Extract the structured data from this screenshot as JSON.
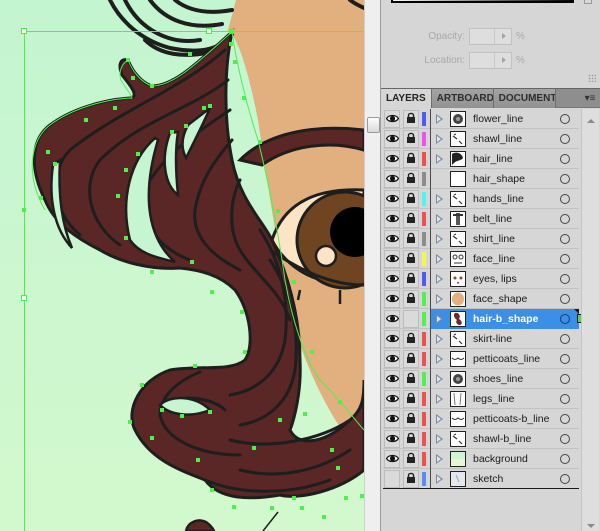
{
  "gradient_panel": {
    "opacity_label": "Opacity:",
    "opacity_value": "",
    "opacity_unit": "%",
    "location_label": "Location:",
    "location_value": "",
    "location_unit": "%"
  },
  "tabs": [
    {
      "label": "LAYERS",
      "active": true
    },
    {
      "label": "ARTBOARD",
      "active": false
    },
    {
      "label": "DOCUMENT",
      "active": false
    }
  ],
  "tab_menu_icon": "panel-menu-icon",
  "layers": [
    {
      "name": "flower_line",
      "visible": true,
      "locked": true,
      "color": "#4f5bf5",
      "expandable": true,
      "selected": false,
      "thumb": "flower"
    },
    {
      "name": "shawl_line",
      "visible": true,
      "locked": true,
      "color": "#f24ff0",
      "expandable": true,
      "selected": false,
      "thumb": "lines"
    },
    {
      "name": "hair_line",
      "visible": true,
      "locked": true,
      "color": "#f24f4f",
      "expandable": true,
      "selected": false,
      "thumb": "hair"
    },
    {
      "name": "hair_shape",
      "visible": true,
      "locked": true,
      "color": "#8c8c8c",
      "expandable": false,
      "selected": false,
      "thumb": "blank"
    },
    {
      "name": "hands_line",
      "visible": true,
      "locked": true,
      "color": "#4ff5f5",
      "expandable": true,
      "selected": false,
      "thumb": "lines"
    },
    {
      "name": "belt_line",
      "visible": true,
      "locked": true,
      "color": "#f24f4f",
      "expandable": true,
      "selected": false,
      "thumb": "belt"
    },
    {
      "name": "shirt_line",
      "visible": true,
      "locked": true,
      "color": "#8c8c8c",
      "expandable": true,
      "selected": false,
      "thumb": "lines"
    },
    {
      "name": "face_line",
      "visible": true,
      "locked": true,
      "color": "#f5f54f",
      "expandable": true,
      "selected": false,
      "thumb": "face"
    },
    {
      "name": "eyes, lips",
      "visible": true,
      "locked": true,
      "color": "#4f5bf5",
      "expandable": true,
      "selected": false,
      "thumb": "eyes"
    },
    {
      "name": "face_shape",
      "visible": true,
      "locked": true,
      "color": "#4ff24f",
      "expandable": true,
      "selected": false,
      "thumb": "faceshape"
    },
    {
      "name": "hair-b_shape",
      "visible": true,
      "locked": false,
      "color": "#4ff24f",
      "expandable": true,
      "selected": true,
      "thumb": "hairb"
    },
    {
      "name": "skirt-line",
      "visible": true,
      "locked": true,
      "color": "#f24f4f",
      "expandable": true,
      "selected": false,
      "thumb": "lines"
    },
    {
      "name": "petticoats_line",
      "visible": true,
      "locked": true,
      "color": "#f24f4f",
      "expandable": true,
      "selected": false,
      "thumb": "wave"
    },
    {
      "name": "shoes_line",
      "visible": true,
      "locked": true,
      "color": "#4ff24f",
      "expandable": true,
      "selected": false,
      "thumb": "flower"
    },
    {
      "name": "legs_line",
      "visible": true,
      "locked": true,
      "color": "#f24f4f",
      "expandable": true,
      "selected": false,
      "thumb": "legs"
    },
    {
      "name": "petticoats-b_line",
      "visible": true,
      "locked": true,
      "color": "#f24f4f",
      "expandable": true,
      "selected": false,
      "thumb": "wave"
    },
    {
      "name": "shawl-b_line",
      "visible": true,
      "locked": true,
      "color": "#f24f4f",
      "expandable": true,
      "selected": false,
      "thumb": "lines"
    },
    {
      "name": "background",
      "visible": true,
      "locked": true,
      "color": "#f24f4f",
      "expandable": true,
      "selected": false,
      "thumb": "bg"
    },
    {
      "name": "sketch",
      "visible": false,
      "locked": true,
      "color": "#5b8cf5",
      "expandable": true,
      "selected": false,
      "thumb": "sketch"
    }
  ],
  "colors": {
    "canvas_bg": "#c6f6d1",
    "skin": "#e2b07e",
    "hair": "#5a2626",
    "outline": "#1e1e1e",
    "iris": "#6e4520",
    "selection": "#4ef04e",
    "selected_layer": "#3b8fe6"
  }
}
